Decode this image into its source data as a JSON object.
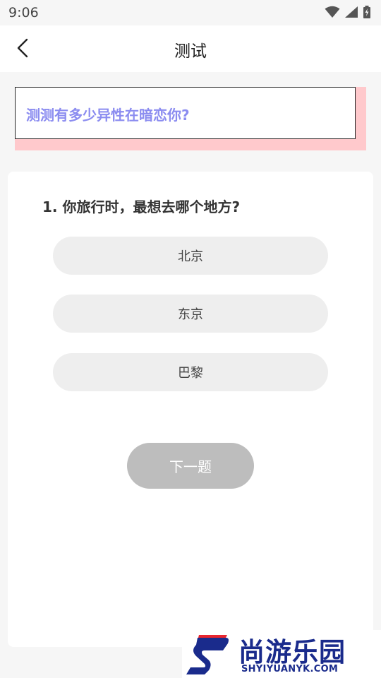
{
  "status_bar": {
    "time": "9:06"
  },
  "header": {
    "title": "测试"
  },
  "banner": {
    "text": "测测有多少异性在暗恋你?"
  },
  "quiz": {
    "question": "1. 你旅行时，最想去哪个地方?",
    "options": [
      "北京",
      "东京",
      "巴黎"
    ],
    "next_label": "下一题"
  },
  "watermark": {
    "name": "尚游乐园",
    "url": "SHYIYUANYK.COM"
  },
  "colors": {
    "banner_text": "#8b8cf0",
    "banner_shadow": "#ffc9cc",
    "option_bg": "#eeeeee",
    "next_button_bg": "#bdbdbd",
    "watermark_blue": "#1a2b8c",
    "watermark_red": "#e8262f"
  }
}
